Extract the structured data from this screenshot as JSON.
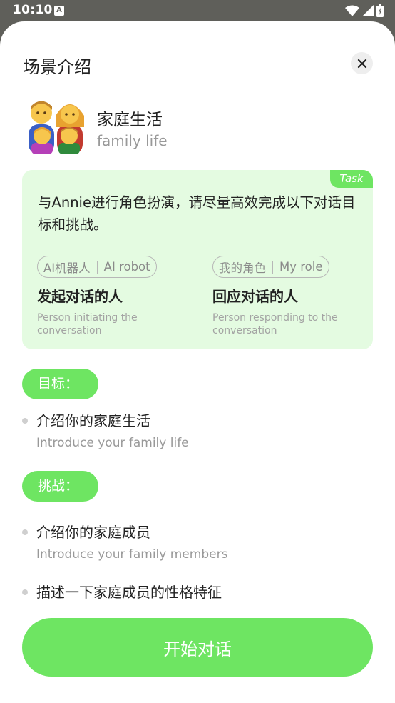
{
  "status_bar": {
    "time": "10:10",
    "notification_badge": "A",
    "icons": [
      "wifi-icon",
      "signal-icon",
      "battery-icon"
    ]
  },
  "sheet": {
    "title": "场景介绍",
    "close_icon": "close-icon"
  },
  "scene": {
    "emoji": "👨‍👩‍👧‍👦",
    "name": "家庭生活",
    "name_en": "family life"
  },
  "task_card": {
    "tag": "Task",
    "description": "与Annie进行角色扮演，请尽量高效完成以下对话目标和挑战。",
    "roles": [
      {
        "pill_cn": "AI机器人",
        "pill_en": "AI robot",
        "title": "发起对话的人",
        "desc": "Person initiating the conversation"
      },
      {
        "pill_cn": "我的角色",
        "pill_en": "My role",
        "title": "回应对话的人",
        "desc": "Person responding to the conversation"
      }
    ]
  },
  "goal": {
    "label": "目标：",
    "items": [
      {
        "text": "介绍你的家庭生活",
        "sub": "Introduce your family life"
      }
    ]
  },
  "challenge": {
    "label": "挑战：",
    "items": [
      {
        "text": "介绍你的家庭成员",
        "sub": "Introduce your family members"
      },
      {
        "text": "描述一下家庭成员的性格特征",
        "sub": ""
      }
    ]
  },
  "start_button": "开始对话",
  "colors": {
    "accent": "#6ee562",
    "card_bg": "#e4fbe1",
    "status_bar": "#5f5f5a"
  }
}
